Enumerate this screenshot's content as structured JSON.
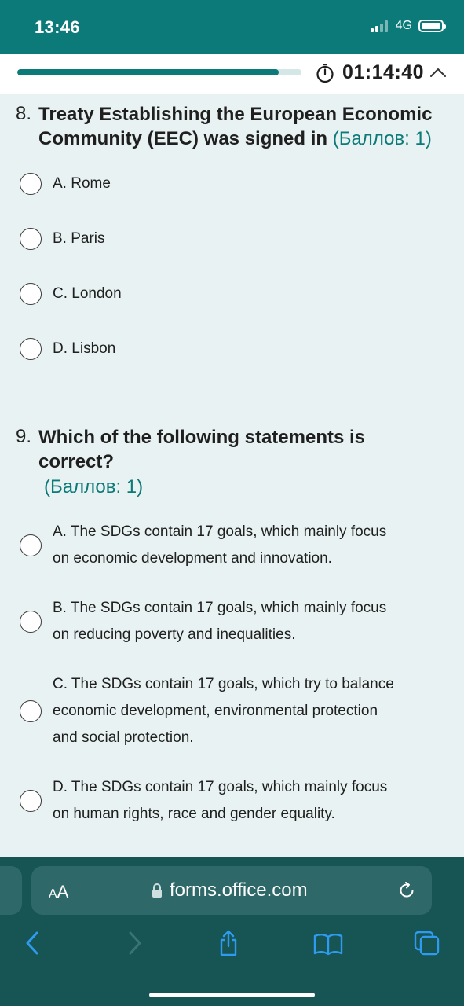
{
  "status": {
    "time": "13:46",
    "network": "4G"
  },
  "header": {
    "progress_fraction": 0.92,
    "timer": "01:14:40"
  },
  "questions": [
    {
      "number": "8.",
      "text_line1": "Treaty Establishing the European Economic",
      "text_line2": "Community (EEC) was signed in",
      "points": "(Баллов: 1)",
      "options": [
        "A. Rome",
        "B. Paris",
        "C. London",
        "D. Lisbon"
      ]
    },
    {
      "number": "9.",
      "text_line1": "Which of the following statements is",
      "text_line2": "correct?",
      "points": "(Баллов: 1)",
      "options": [
        [
          "A. The SDGs contain 17 goals, which mainly focus",
          "on economic development and innovation."
        ],
        [
          "B. The SDGs contain 17 goals, which mainly focus",
          "on reducing poverty and inequalities."
        ],
        [
          "C. The SDGs contain 17 goals, which try to balance",
          "economic development, environmental protection",
          "and social protection."
        ],
        [
          "D. The SDGs contain 17 goals, which mainly focus",
          "on human rights, race and gender equality."
        ]
      ]
    }
  ],
  "browser": {
    "text_size_label_small": "A",
    "text_size_label_large": "A",
    "url": "forms.office.com"
  },
  "colors": {
    "accent": "#0b7a78",
    "browser_bg": "#175454"
  },
  "icons": [
    "stopwatch-icon",
    "chevron-up-icon",
    "lock-icon",
    "reload-icon",
    "back-icon",
    "forward-icon",
    "share-icon",
    "bookmarks-icon",
    "tabs-icon"
  ]
}
